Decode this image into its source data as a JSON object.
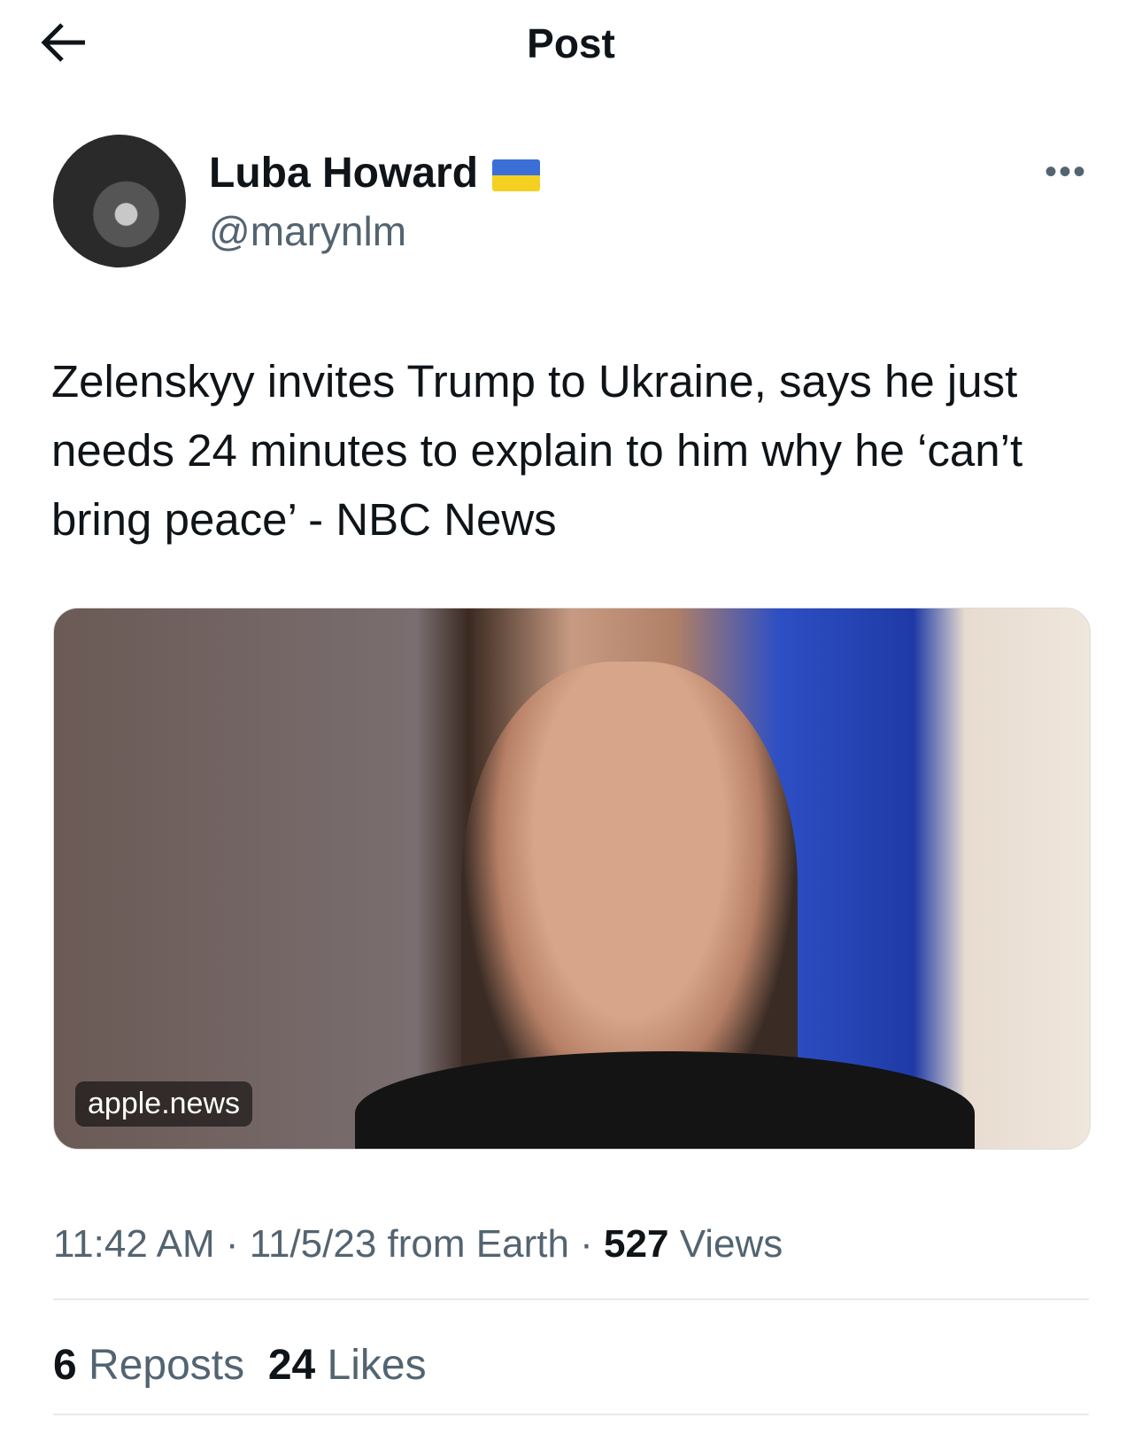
{
  "header": {
    "title": "Post",
    "back_icon": "arrow-left-icon"
  },
  "author": {
    "name": "Luba Howard",
    "flag": "ukraine-flag",
    "handle": "@marynlm"
  },
  "post": {
    "text": "Zelenskyy invites Trump to Ukraine, says he just needs 24 minutes to explain to him why he ‘can’t bring peace’ - NBC News",
    "media_source": "apple.news",
    "time": "11:42 AM",
    "date": "11/5/23",
    "from": "from Earth",
    "views": "527",
    "views_label": "Views",
    "reposts": "6",
    "reposts_label": "Reposts",
    "likes": "24",
    "likes_label": "Likes"
  }
}
